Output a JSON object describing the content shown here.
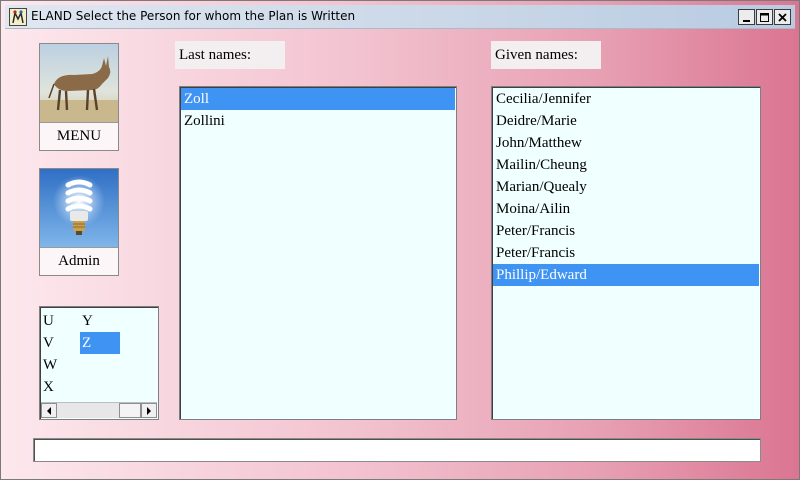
{
  "window": {
    "title": "ELAND Select the Person for whom the Plan is Written",
    "controls": [
      "minimize",
      "maximize",
      "close"
    ]
  },
  "tiles": [
    {
      "label": "MENU",
      "icon": "eland-antelope-icon"
    },
    {
      "label": "Admin",
      "icon": "light-bulb-icon"
    }
  ],
  "letters": {
    "col1": [
      "U",
      "V",
      "W",
      "X"
    ],
    "col2": [
      "Y",
      "Z"
    ],
    "selected": "Z"
  },
  "last_names": {
    "label": "Last names:",
    "items": [
      "Zoll",
      "Zollini"
    ],
    "selected_index": 0
  },
  "given_names": {
    "label": "Given names:",
    "items": [
      "Cecilia/Jennifer",
      "Deidre/Marie",
      "John/Matthew",
      "Mailin/Cheung",
      "Marian/Quealy",
      "Moina/Ailin",
      "Peter/Francis",
      "Peter/Francis",
      "Phillip/Edward"
    ],
    "selected_index": 8
  },
  "status": {
    "text": ""
  },
  "colors": {
    "selection": "#3f93f2",
    "list_bg": "#f0ffff"
  }
}
